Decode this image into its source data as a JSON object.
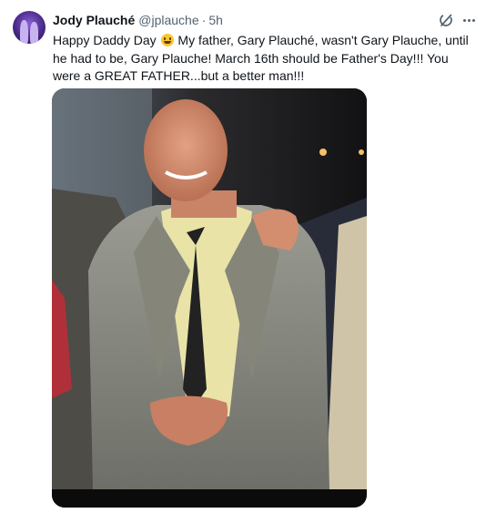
{
  "post": {
    "author_name": "Jody Plauché",
    "author_handle": "@jplauche",
    "separator": "·",
    "time": "5h",
    "text_before_emoji": "Happy Daddy Day",
    "text_after_emoji": "My father, Gary Plauché, wasn't Gary Plauche, until he had to be, Gary Plauche! March 16th should be Father's Day!!! You were a GREAT FATHER...but a better man!!!",
    "emoji": "grinning-face-emoji"
  },
  "icons": {
    "grok": "grok-icon",
    "more": "more-options-icon"
  },
  "colors": {
    "text_primary": "#0f1419",
    "text_secondary": "#536471",
    "suit": "#8e8f86",
    "shirt": "#e9e3a8",
    "tie": "#222222"
  }
}
